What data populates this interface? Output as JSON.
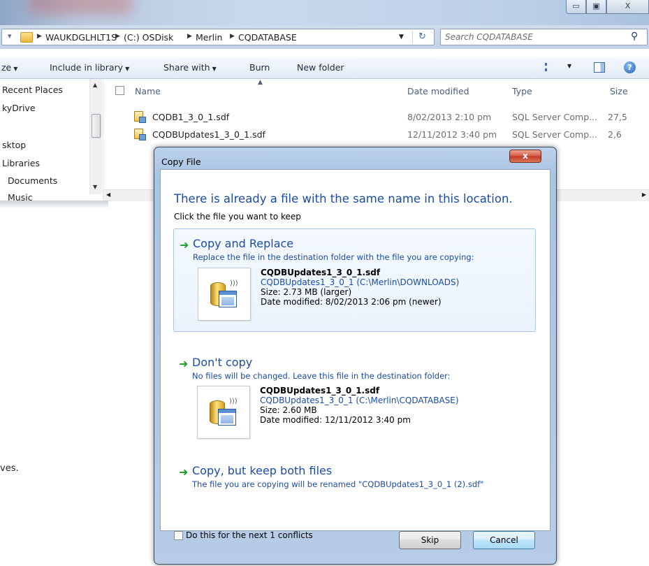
{
  "window": {
    "caption_buttons": {
      "minimize": "▭",
      "maximize": "▣",
      "close": "X"
    }
  },
  "address": {
    "crumbs": [
      "WAUKDGLHLT1S",
      "(C:) OSDisk",
      "Merlin",
      "CQDATABASE"
    ],
    "search_placeholder": "Search CQDATABASE"
  },
  "toolbar": {
    "organize": "ze",
    "include_in_library": "Include in library",
    "share_with": "Share with",
    "burn": "Burn",
    "new_folder": "New folder"
  },
  "nav": {
    "items": [
      "Recent Places",
      "kyDrive",
      "sktop",
      "Libraries",
      "Documents",
      "Music"
    ]
  },
  "filelist": {
    "columns": {
      "name": "Name",
      "date": "Date modified",
      "type": "Type",
      "size": "Size"
    },
    "rows": [
      {
        "name": "CQDB1_3_0_1.sdf",
        "date": "8/02/2013 2:10 pm",
        "type": "SQL Server Comp...",
        "size": "27,5"
      },
      {
        "name": "CQDBUpdates1_3_0_1.sdf",
        "date": "12/11/2012 3:40 pm",
        "type": "SQL Server Comp...",
        "size": "2,6"
      }
    ]
  },
  "background_text": "ves.",
  "dialog": {
    "title": "Copy File",
    "close_label": "x",
    "heading": "There is already a file with the same name in this location.",
    "subheading": "Click the file you want to keep",
    "replace": {
      "title": "Copy and Replace",
      "description": "Replace the file in the destination folder with the file you are copying:",
      "file_name": "CQDBUpdates1_3_0_1.sdf",
      "file_path": "CQDBUpdates1_3_0_1 (C:\\Merlin\\DOWNLOADS)",
      "size": "Size: 2.73 MB (larger)",
      "date": "Date modified: 8/02/2013 2:06 pm (newer)"
    },
    "dont_copy": {
      "title": "Don't copy",
      "description": "No files will be changed. Leave this file in the destination folder:",
      "file_name": "CQDBUpdates1_3_0_1.sdf",
      "file_path": "CQDBUpdates1_3_0_1 (C:\\Merlin\\CQDATABASE)",
      "size": "Size: 2.60 MB",
      "date": "Date modified: 12/11/2012 3:40 pm"
    },
    "keep_both": {
      "title": "Copy, but keep both files",
      "description": "The file you are copying will be renamed \"CQDBUpdates1_3_0_1 (2).sdf\""
    },
    "footer": {
      "checkbox_label": "Do this for the next 1 conflicts",
      "skip": "Skip",
      "cancel": "Cancel"
    }
  },
  "colors": {
    "link_blue": "#1a4ca8",
    "arrow_green": "#24a02d",
    "close_red": "#c0392b"
  }
}
